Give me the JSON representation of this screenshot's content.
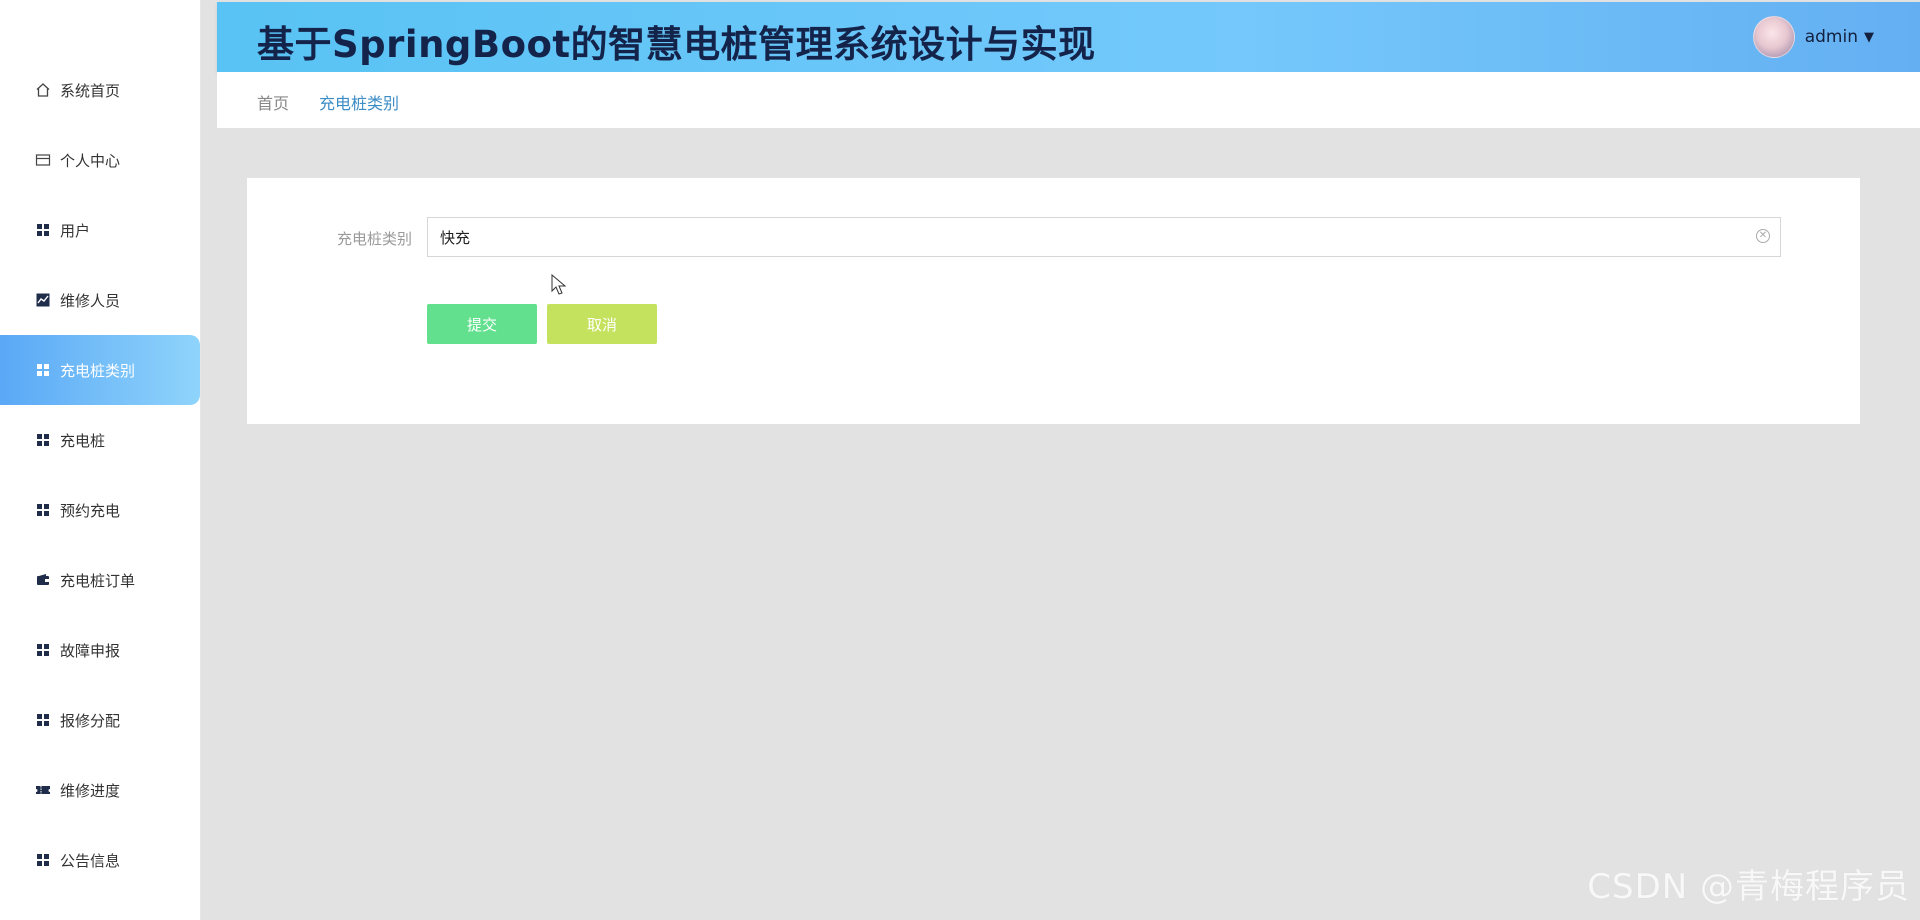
{
  "app": {
    "title": "基于SpringBoot的智慧电桩管理系统设计与实现",
    "user": "admin"
  },
  "sidebar": {
    "items": [
      {
        "label": "系统首页",
        "icon": "home-icon"
      },
      {
        "label": "个人中心",
        "icon": "profile-card-icon"
      },
      {
        "label": "用户",
        "icon": "grid-icon"
      },
      {
        "label": "维修人员",
        "icon": "chart-icon"
      },
      {
        "label": "充电桩类别",
        "icon": "grid-icon",
        "active": true
      },
      {
        "label": "充电桩",
        "icon": "grid-icon"
      },
      {
        "label": "预约充电",
        "icon": "grid-icon"
      },
      {
        "label": "充电桩订单",
        "icon": "wallet-icon"
      },
      {
        "label": "故障申报",
        "icon": "grid-icon"
      },
      {
        "label": "报修分配",
        "icon": "grid-icon"
      },
      {
        "label": "维修进度",
        "icon": "ticket-icon"
      },
      {
        "label": "公告信息",
        "icon": "grid-icon"
      }
    ]
  },
  "breadcrumb": {
    "home": "首页",
    "current": "充电桩类别"
  },
  "form": {
    "category_label": "充电桩类别",
    "category_value": "快充",
    "submit_label": "提交",
    "cancel_label": "取消"
  },
  "watermark": "CSDN @青梅程序员",
  "colors": {
    "header_gradient_start": "#58c3f4",
    "header_gradient_end": "#64aff2",
    "active_menu": "#5aa8f6",
    "submit_button": "#62e08e",
    "cancel_button": "#c5e25e",
    "breadcrumb_current": "#3c8cc6"
  }
}
